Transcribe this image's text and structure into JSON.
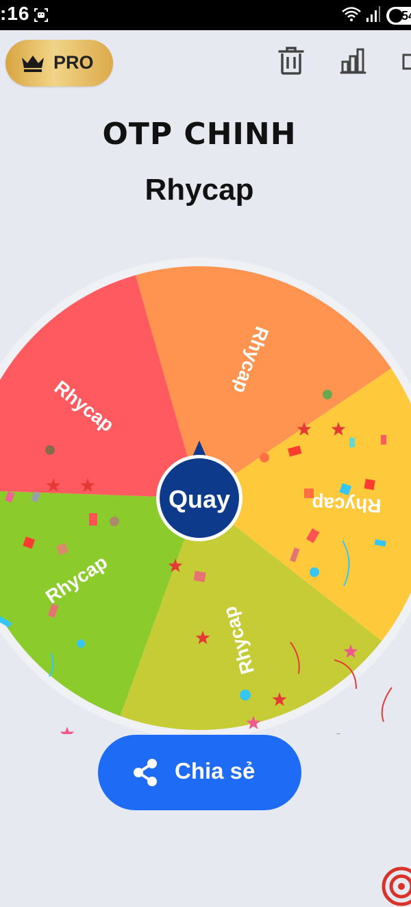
{
  "status_bar": {
    "time": ":16",
    "battery": "54"
  },
  "header": {
    "pro_label": "PRO"
  },
  "wheel": {
    "title": "OTP CHINH",
    "current_result": "Rhycap",
    "center_button_label": "Quay",
    "segments": [
      {
        "label": "Rhycap",
        "color": "#ff9350"
      },
      {
        "label": "Rhycap",
        "color": "#ffc93c"
      },
      {
        "label": "Rhycap",
        "color": "#c5cc35"
      },
      {
        "label": "Rhycap",
        "color": "#8bcb2c"
      },
      {
        "label": "Rhycap",
        "color": "#ff5a5f"
      }
    ],
    "hub_color": "#0e3a8c"
  },
  "share": {
    "label": "Chia sẻ",
    "color": "#1e6cf5"
  }
}
